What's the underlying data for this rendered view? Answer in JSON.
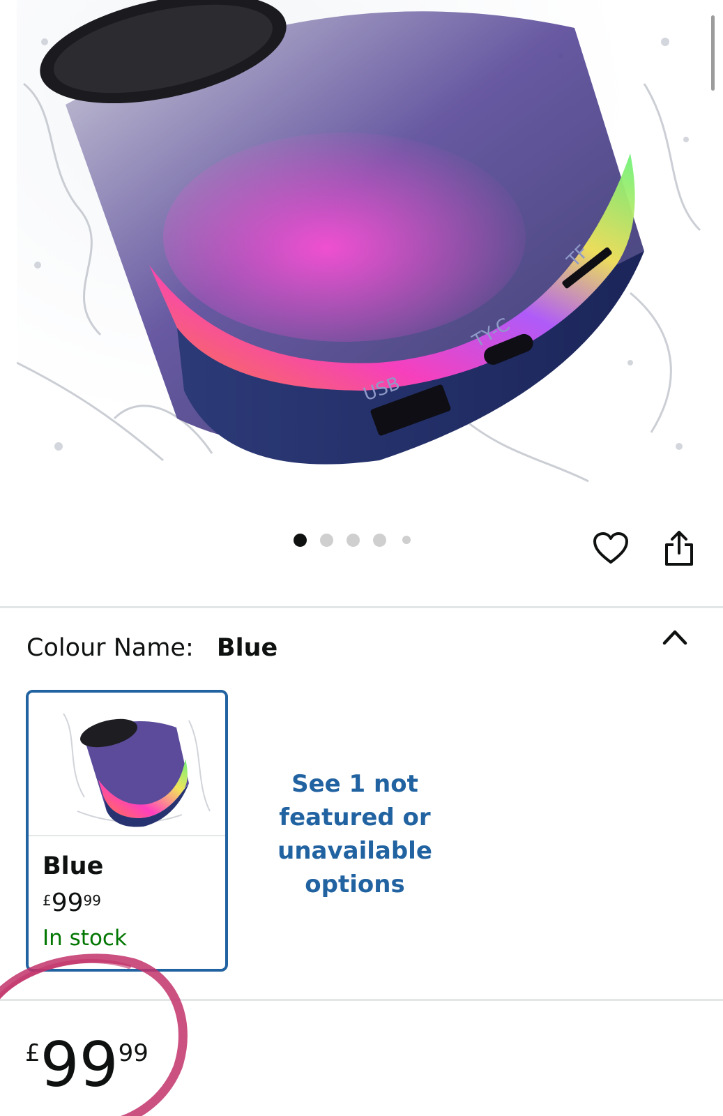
{
  "product_image": {
    "alt": "Blue LED portable Bluetooth speaker with water splash",
    "port_labels": [
      "USB",
      "TY-C",
      "TF"
    ]
  },
  "carousel": {
    "dot_count": 5,
    "active_index": 0
  },
  "actions": {
    "wishlist_icon": "heart-icon",
    "share_icon": "share-icon"
  },
  "colour": {
    "label": "Colour Name:",
    "selected_value": "Blue",
    "collapse_icon": "chevron-up-icon",
    "swatches": [
      {
        "name": "Blue",
        "currency": "£",
        "price_whole": "99",
        "price_fraction": "99",
        "stock": "In stock"
      }
    ],
    "more_options_link": "See 1 not featured or unavailable options"
  },
  "price": {
    "currency": "£",
    "whole": "99",
    "fraction": "99"
  },
  "colors": {
    "accent_blue": "#2162a1",
    "stock_green": "#007600",
    "annotation_pink": "#c2336b"
  }
}
